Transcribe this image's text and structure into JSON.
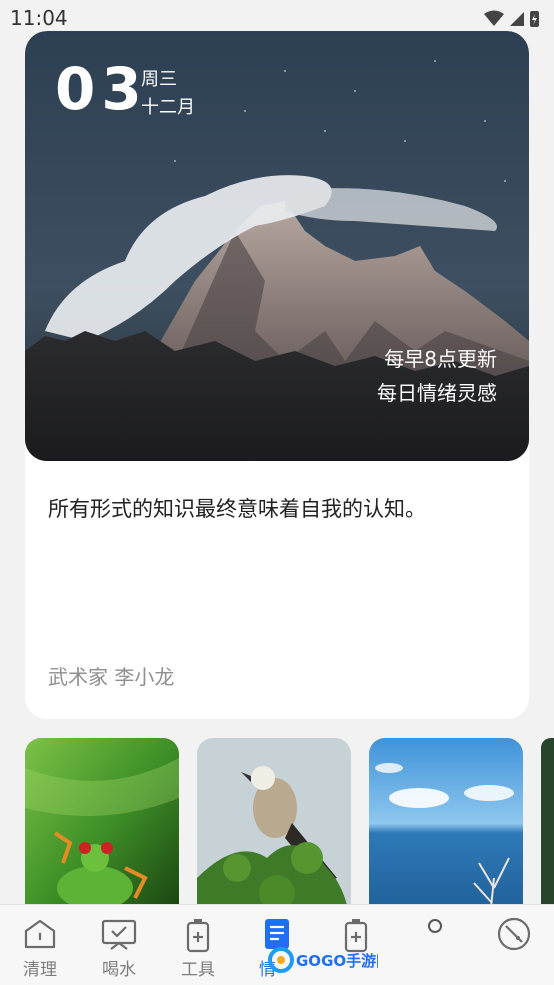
{
  "status_bar": {
    "time": "11:04"
  },
  "hero": {
    "day": "03",
    "weekday": "周三",
    "month": "十二月",
    "update_line1": "每早8点更新",
    "update_line2": "每日情绪灵感",
    "image_icon": "mountain-photo"
  },
  "quote": {
    "text": "所有形式的知识最终意味着自我的认知。",
    "author": "武术家 李小龙"
  },
  "thumbnails": [
    {
      "subject": "frog"
    },
    {
      "subject": "bird"
    },
    {
      "subject": "sea"
    }
  ],
  "nav": {
    "items": [
      {
        "label": "清理",
        "icon": "cleanup-icon"
      },
      {
        "label": "喝水",
        "icon": "water-icon"
      },
      {
        "label": "工具",
        "icon": "tools-icon"
      },
      {
        "label": "情",
        "icon": "mood-icon",
        "active": true
      },
      {
        "label": "",
        "icon": "battery-icon"
      },
      {
        "label": "",
        "icon": "circle-icon"
      },
      {
        "label": "",
        "icon": "compass-icon"
      }
    ]
  },
  "watermark": {
    "text": "GOGO手游网"
  },
  "colors": {
    "accent": "#1f6ff5",
    "background": "#f2f2f2"
  }
}
